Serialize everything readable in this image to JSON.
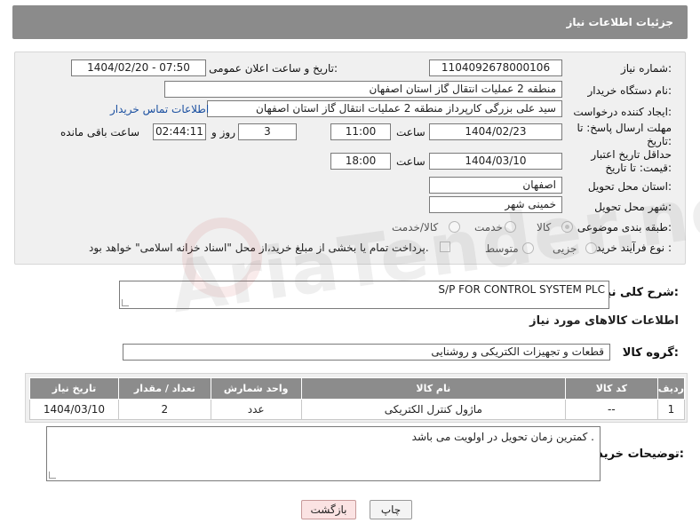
{
  "header": {
    "title": "جزئیات اطلاعات نیاز"
  },
  "form": {
    "need_number": {
      "label": "شماره نیاز:",
      "value": "1104092678000106"
    },
    "announce_datetime": {
      "label": "تاریخ و ساعت اعلان عمومی:",
      "value": "1404/02/20 - 07:50"
    },
    "buyer_org": {
      "label": "نام دستگاه خریدار:",
      "value": "منطقه 2 عملیات انتقال گاز استان اصفهان"
    },
    "requester": {
      "label": "ایجاد کننده درخواست:",
      "value": "سید علی بزرگی کارپرداز منطقه 2 عملیات انتقال گاز استان اصفهان",
      "link": "اطلاعات تماس خریدار"
    },
    "reply_deadline": {
      "label": "مهلت ارسال پاسخ: تا تاریخ:",
      "date": "1404/02/23",
      "time_label": "ساعت",
      "time": "11:00",
      "days": "3",
      "days_label": "روز و",
      "remaining": "02:44:11",
      "remaining_label": "ساعت باقی مانده"
    },
    "price_validity": {
      "label": "حداقل تاریخ اعتبار قیمت: تا تاریخ:",
      "date": "1404/03/10",
      "time_label": "ساعت",
      "time": "18:00"
    },
    "delivery_province": {
      "label": "استان محل تحویل:",
      "value": "اصفهان"
    },
    "delivery_city": {
      "label": "شهر محل تحویل:",
      "value": "خمینی شهر"
    },
    "category": {
      "label": "طبقه بندی موضوعی:",
      "options": [
        "کالا",
        "خدمت",
        "کالا/خدمت"
      ],
      "selected": "کالا"
    },
    "purchase_type": {
      "label": "نوع فرآیند خرید :",
      "options": [
        "جزیی",
        "متوسط"
      ],
      "note": "پرداخت تمام یا بخشی از مبلغ خرید،از محل \"اسناد خزانه اسلامی\" خواهد بود."
    }
  },
  "description": {
    "label": "شرح کلی نیاز:",
    "value": "S/P   FOR CONTROL SYSTEM PLC"
  },
  "goods_info": {
    "title": "اطلاعات کالاهای مورد نیاز"
  },
  "goods_group": {
    "label": "گروه کالا:",
    "value": "قطعات و تجهیزات الکتریکی و روشنایی"
  },
  "table": {
    "headers": [
      "ردیف",
      "کد کالا",
      "نام کالا",
      "واحد شمارش",
      "تعداد / مقدار",
      "تاریخ نیاز"
    ],
    "rows": [
      {
        "row": "1",
        "code": "--",
        "name": "ماژول کنترل الکتریکی",
        "unit": "عدد",
        "qty": "2",
        "date": "1404/03/10"
      }
    ]
  },
  "buyer_notes": {
    "label": "توضیحات خریدار:",
    "value": "کمترین زمان تحویل در اولویت می باشد ."
  },
  "buttons": {
    "print": "چاپ",
    "back": "بازگشت"
  },
  "watermark": "AriaTender.net"
}
